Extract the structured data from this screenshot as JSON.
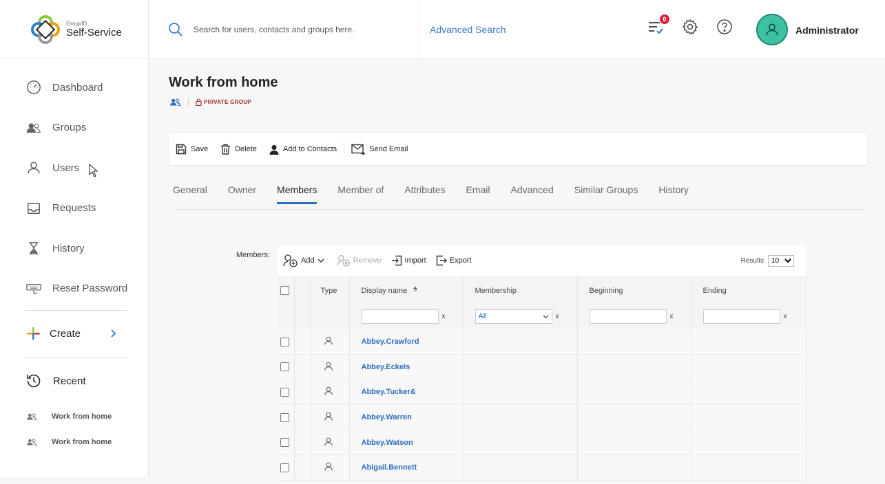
{
  "brand": {
    "small": "GroupID",
    "big": "Self-Service"
  },
  "search": {
    "placeholder": "Search for users, contacts and groups here.",
    "advanced": "Advanced Search"
  },
  "notifications": {
    "count": "0"
  },
  "user": {
    "name": "Administrator"
  },
  "sidebar": {
    "items": [
      {
        "label": "Dashboard",
        "icon": "dashboard-icon"
      },
      {
        "label": "Groups",
        "icon": "groups-icon"
      },
      {
        "label": "Users",
        "icon": "user-icon"
      },
      {
        "label": "Requests",
        "icon": "inbox-icon"
      },
      {
        "label": "History",
        "icon": "hourglass-icon"
      },
      {
        "label": "Reset Password",
        "icon": "keyboard-icon"
      }
    ],
    "create": "Create",
    "recent": "Recent",
    "recent_items": [
      "Work from home",
      "Work from home"
    ]
  },
  "page": {
    "title": "Work from home",
    "group_type": "PRIVATE GROUP"
  },
  "toolbar": {
    "save": "Save",
    "delete": "Delete",
    "add_contacts": "Add to Contacts",
    "send_email": "Send Email"
  },
  "tabs": [
    "General",
    "Owner",
    "Members",
    "Member of",
    "Attributes",
    "Email",
    "Advanced",
    "Similar Groups",
    "History"
  ],
  "active_tab": "Members",
  "members": {
    "label": "Members:",
    "add": "Add",
    "remove": "Remove",
    "import": "Import",
    "export": "Export",
    "results_label": "Results",
    "results_value": "10",
    "columns": [
      "Type",
      "Display name",
      "Membership",
      "Beginning",
      "Ending"
    ],
    "membership_filter": "All",
    "filter_clear": "x",
    "rows": [
      "Abbey.Crawford",
      "Abbey.Eckels",
      "Abbey.Tucker&",
      "Abbey.Warren",
      "Abbey.Watson",
      "Abigail.Bennett"
    ]
  },
  "colors": {
    "accent": "#2a6fbd",
    "avatar": "#3fbfa4",
    "badge": "#d9233a",
    "private": "#a02b2b"
  }
}
